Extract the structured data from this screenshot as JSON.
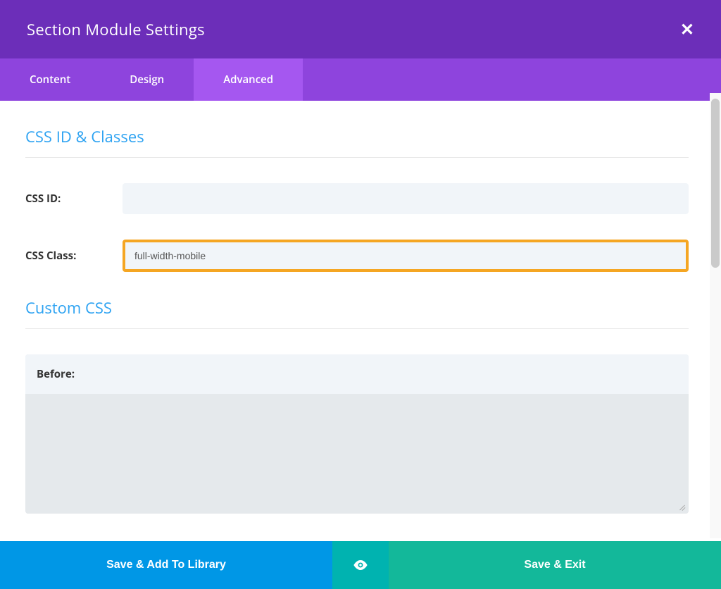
{
  "header": {
    "title": "Section Module Settings"
  },
  "tabs": [
    {
      "label": "Content",
      "active": false
    },
    {
      "label": "Design",
      "active": false
    },
    {
      "label": "Advanced",
      "active": true
    }
  ],
  "sections": {
    "cssIdClasses": {
      "title": "CSS ID & Classes",
      "fields": {
        "cssId": {
          "label": "CSS ID:",
          "value": ""
        },
        "cssClass": {
          "label": "CSS Class:",
          "value": "full-width-mobile"
        }
      }
    },
    "customCss": {
      "title": "Custom CSS",
      "blocks": {
        "before": {
          "label": "Before:",
          "value": ""
        }
      }
    }
  },
  "footer": {
    "saveLibrary": "Save & Add To Library",
    "saveExit": "Save & Exit"
  }
}
